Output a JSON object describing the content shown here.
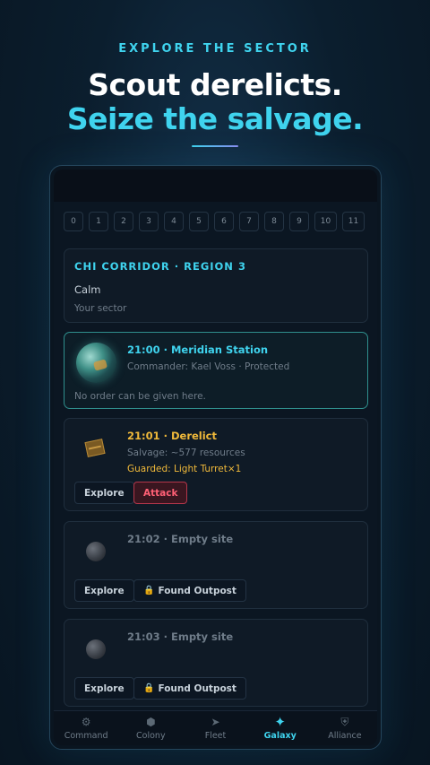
{
  "header": {
    "eyebrow": "EXPLORE THE SECTOR",
    "line1": "Scout derelicts.",
    "line2": "Seize the salvage."
  },
  "slots": [
    "0",
    "1",
    "2",
    "3",
    "4",
    "5",
    "6",
    "7",
    "8",
    "9",
    "10",
    "11"
  ],
  "region": {
    "title": "CHI CORRIDOR · REGION 3",
    "status": "Calm",
    "subtitle": "Your sector"
  },
  "sites": [
    {
      "title": "21:00 · Meridian Station",
      "subtitle": "Commander: Kael Voss · Protected",
      "note": "No order can be given here."
    },
    {
      "title": "21:01 · Derelict",
      "subtitle": "Salvage: ~577 resources",
      "guard": "Guarded: Light Turret×1",
      "actions": [
        "Explore",
        "Attack"
      ]
    },
    {
      "title": "21:02 · Empty site",
      "actions": [
        "Explore",
        "Found Outpost"
      ]
    },
    {
      "title": "21:03 · Empty site",
      "actions": [
        "Explore",
        "Found Outpost"
      ]
    }
  ],
  "nav": [
    {
      "label": "Command",
      "icon": "command-icon"
    },
    {
      "label": "Colony",
      "icon": "colony-hexagon-icon"
    },
    {
      "label": "Fleet",
      "icon": "fleet-arrow-icon"
    },
    {
      "label": "Galaxy",
      "icon": "galaxy-star-icon",
      "active": true
    },
    {
      "label": "Alliance",
      "icon": "alliance-shield-icon"
    }
  ],
  "colors": {
    "accent": "#3fd3ee",
    "warning": "#f0b93a",
    "danger": "#ff6075"
  }
}
